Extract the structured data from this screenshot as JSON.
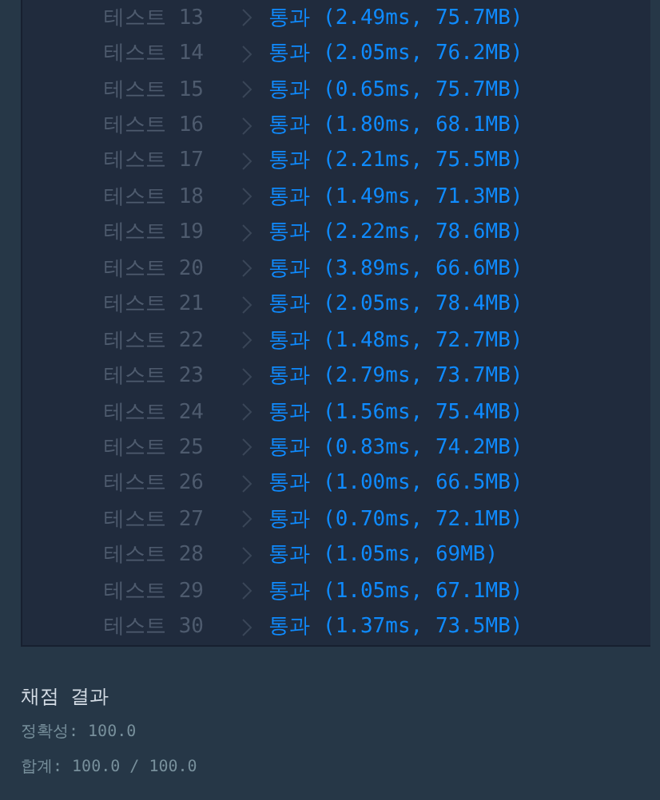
{
  "tests": [
    {
      "label": "테스트 13",
      "result": "통과",
      "detail": "(2.49ms, 75.7MB)"
    },
    {
      "label": "테스트 14",
      "result": "통과",
      "detail": "(2.05ms, 76.2MB)"
    },
    {
      "label": "테스트 15",
      "result": "통과",
      "detail": "(0.65ms, 75.7MB)"
    },
    {
      "label": "테스트 16",
      "result": "통과",
      "detail": "(1.80ms, 68.1MB)"
    },
    {
      "label": "테스트 17",
      "result": "통과",
      "detail": "(2.21ms, 75.5MB)"
    },
    {
      "label": "테스트 18",
      "result": "통과",
      "detail": "(1.49ms, 71.3MB)"
    },
    {
      "label": "테스트 19",
      "result": "통과",
      "detail": "(2.22ms, 78.6MB)"
    },
    {
      "label": "테스트 20",
      "result": "통과",
      "detail": "(3.89ms, 66.6MB)"
    },
    {
      "label": "테스트 21",
      "result": "통과",
      "detail": "(2.05ms, 78.4MB)"
    },
    {
      "label": "테스트 22",
      "result": "통과",
      "detail": "(1.48ms, 72.7MB)"
    },
    {
      "label": "테스트 23",
      "result": "통과",
      "detail": "(2.79ms, 73.7MB)"
    },
    {
      "label": "테스트 24",
      "result": "통과",
      "detail": "(1.56ms, 75.4MB)"
    },
    {
      "label": "테스트 25",
      "result": "통과",
      "detail": "(0.83ms, 74.2MB)"
    },
    {
      "label": "테스트 26",
      "result": "통과",
      "detail": "(1.00ms, 66.5MB)"
    },
    {
      "label": "테스트 27",
      "result": "통과",
      "detail": "(0.70ms, 72.1MB)"
    },
    {
      "label": "테스트 28",
      "result": "통과",
      "detail": "(1.05ms, 69MB)"
    },
    {
      "label": "테스트 29",
      "result": "통과",
      "detail": "(1.05ms, 67.1MB)"
    },
    {
      "label": "테스트 30",
      "result": "통과",
      "detail": "(1.37ms, 73.5MB)"
    }
  ],
  "summary": {
    "title": "채점 결과",
    "lines": [
      "정확성: 100.0",
      "합계: 100.0 / 100.0"
    ]
  }
}
